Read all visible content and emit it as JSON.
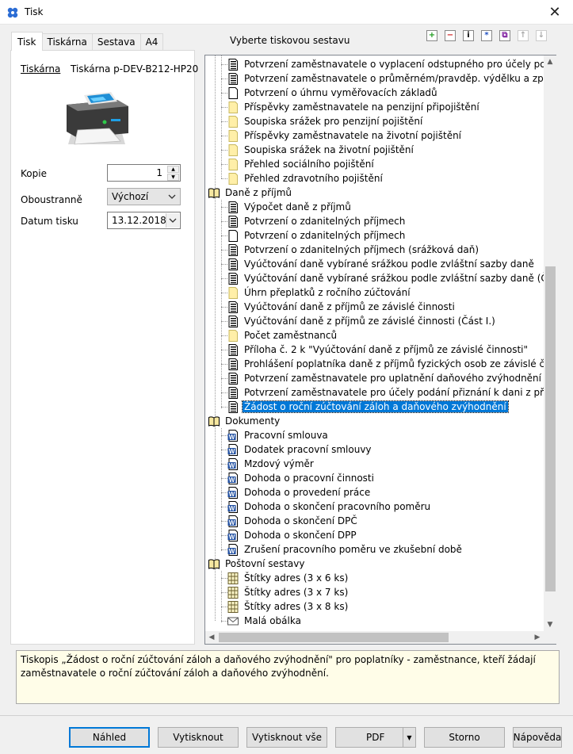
{
  "window": {
    "title": "Tisk",
    "close_glyph": "✕"
  },
  "tabs": [
    {
      "label": "Tisk",
      "active": true
    },
    {
      "label": "Tiskárna",
      "active": false
    },
    {
      "label": "Sestava",
      "active": false
    },
    {
      "label": "A4",
      "active": false
    }
  ],
  "printer": {
    "link_label": "Tiskárna",
    "name": "Tiskárna p-DEV-B212-HP20"
  },
  "form": {
    "copies_label": "Kopie",
    "copies_value": "1",
    "duplex_label": "Oboustranně",
    "duplex_value": "Výchozí",
    "date_label": "Datum tisku",
    "date_value": "13.12.2018"
  },
  "tree_header": "Vyberte tiskovou sestavu",
  "toolbar_icons": [
    "add-icon",
    "remove-icon",
    "info-icon",
    "asterisk-icon",
    "copy-icon",
    "move-up-icon",
    "move-down-icon"
  ],
  "tree": {
    "items": [
      {
        "label": "Potvrzení zaměstnavatele o vyplacení odstupného pro účely poskytování",
        "icon": "doc-lines-icon",
        "level": 1
      },
      {
        "label": "Potvrzení zaměstnavatele o průměrném/pravděp. výdělku a způsobu ukc",
        "icon": "doc-lines-icon",
        "level": 1
      },
      {
        "label": "Potvrzení o úhrnu vyměřovacích základů",
        "icon": "doc-blank-icon",
        "level": 1
      },
      {
        "label": "Příspěvky zaměstnavatele na penzijní připojištění",
        "icon": "doc-yellow-icon",
        "level": 1
      },
      {
        "label": "Soupiska srážek pro penzijní pojištění",
        "icon": "doc-yellow-icon",
        "level": 1
      },
      {
        "label": "Příspěvky zaměstnavatele na životní pojištění",
        "icon": "doc-yellow-icon",
        "level": 1
      },
      {
        "label": "Soupiska srážek na životní pojištění",
        "icon": "doc-yellow-icon",
        "level": 1
      },
      {
        "label": "Přehled sociálního pojištění",
        "icon": "doc-yellow-icon",
        "level": 1
      },
      {
        "label": "Přehled zdravotního pojištění",
        "icon": "doc-yellow-icon",
        "level": 1
      },
      {
        "label": "Daně z příjmů",
        "icon": "book-icon",
        "level": 0
      },
      {
        "label": "Výpočet daně z příjmů",
        "icon": "doc-lines-icon",
        "level": 1
      },
      {
        "label": "Potvrzení o zdanitelných příjmech",
        "icon": "doc-lines-icon",
        "level": 1
      },
      {
        "label": "Potvrzení o zdanitelných příjmech",
        "icon": "doc-blank-icon",
        "level": 1
      },
      {
        "label": "Potvrzení o zdanitelných příjmech (srážková daň)",
        "icon": "doc-lines-icon",
        "level": 1
      },
      {
        "label": "Vyúčtování daně vybírané srážkou podle zvláštní sazby daně",
        "icon": "doc-lines-icon",
        "level": 1
      },
      {
        "label": "Vyúčtování daně vybírané srážkou podle zvláštní sazby daně (Část I.)",
        "icon": "doc-lines-icon",
        "level": 1
      },
      {
        "label": "Úhrn přeplatků z ročního zúčtování",
        "icon": "doc-yellow-icon",
        "level": 1
      },
      {
        "label": "Vyúčtování daně z příjmů ze závislé činnosti",
        "icon": "doc-lines-icon",
        "level": 1
      },
      {
        "label": "Vyúčtování daně z příjmů ze závislé činnosti (Část I.)",
        "icon": "doc-lines-icon",
        "level": 1
      },
      {
        "label": "Počet zaměstnanců",
        "icon": "doc-yellow-icon",
        "level": 1
      },
      {
        "label": "Příloha č. 2 k \"Vyúčtování daně z příjmů ze závislé činnosti\"",
        "icon": "doc-lines-icon",
        "level": 1
      },
      {
        "label": "Prohlášení poplatníka daně z příjmů fyzických osob ze závislé činnosti",
        "icon": "doc-lines-icon",
        "level": 1
      },
      {
        "label": "Potvrzení zaměstnavatele pro uplatnění daňového zvýhodnění",
        "icon": "doc-lines-icon",
        "level": 1
      },
      {
        "label": "Potvrzení zaměstnavatele pro účely podání přiznání k dani z příjmů",
        "icon": "doc-lines-icon",
        "level": 1
      },
      {
        "label": "Žádost o roční zúčtování záloh a daňového zvýhodnění",
        "icon": "doc-lines-icon",
        "level": 1,
        "selected": true
      },
      {
        "label": "Dokumenty",
        "icon": "book-icon",
        "level": 0
      },
      {
        "label": "Pracovní smlouva",
        "icon": "word-icon",
        "level": 1
      },
      {
        "label": "Dodatek pracovní smlouvy",
        "icon": "word-icon",
        "level": 1
      },
      {
        "label": "Mzdový výměr",
        "icon": "word-icon",
        "level": 1
      },
      {
        "label": "Dohoda o pracovní činnosti",
        "icon": "word-icon",
        "level": 1
      },
      {
        "label": "Dohoda o provedení práce",
        "icon": "word-icon",
        "level": 1
      },
      {
        "label": "Dohoda o skončení pracovního poměru",
        "icon": "word-icon",
        "level": 1
      },
      {
        "label": "Dohoda o skončení DPČ",
        "icon": "word-icon",
        "level": 1
      },
      {
        "label": "Dohoda o skončení DPP",
        "icon": "word-icon",
        "level": 1
      },
      {
        "label": "Zrušení pracovního poměru ve zkušební době",
        "icon": "word-icon",
        "level": 1
      },
      {
        "label": "Poštovní sestavy",
        "icon": "book-icon",
        "level": 0
      },
      {
        "label": "Štítky adres (3 x 6 ks)",
        "icon": "labels-icon",
        "level": 1
      },
      {
        "label": "Štítky adres (3 x 7 ks)",
        "icon": "labels-icon",
        "level": 1
      },
      {
        "label": "Štítky adres (3 x 8 ks)",
        "icon": "labels-icon",
        "level": 1
      },
      {
        "label": "Malá obálka",
        "icon": "envelope-icon",
        "level": 1
      }
    ]
  },
  "description": "Tiskopis „Žádost o roční zúčtování záloh a daňového zvýhodnění\" pro poplatníky - zaměstnance, kteří žádají zaměstnavatele o roční zúčtování záloh a daňového zvýhodnění.",
  "buttons": {
    "preview": "Náhled",
    "print": "Vytisknout",
    "print_all": "Vytisknout vše",
    "pdf": "PDF",
    "cancel": "Storno",
    "help": "Nápověda"
  },
  "colors": {
    "selection": "#0078d7",
    "description_bg": "#fffde8"
  }
}
